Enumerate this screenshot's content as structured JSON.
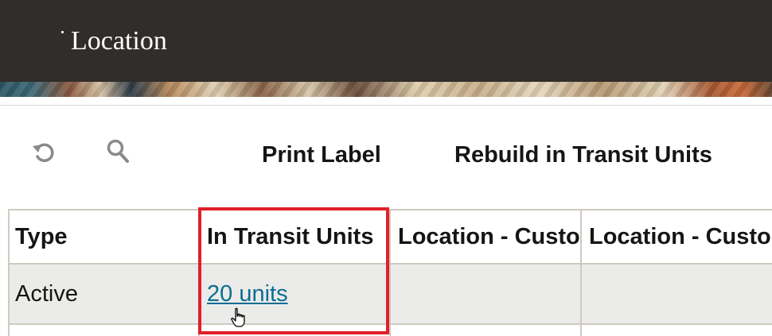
{
  "header": {
    "title": "Location"
  },
  "toolbar": {
    "refresh_icon": "refresh-icon",
    "search_icon": "search-icon",
    "print_label": "Print Label",
    "rebuild_label": "Rebuild in Transit Units"
  },
  "table": {
    "columns": [
      "Type",
      "In Transit Units",
      "Location - Customer",
      "Location - Customer"
    ],
    "rows": [
      {
        "type": "Active",
        "in_transit_units": "20 units",
        "col3": "",
        "col4": ""
      }
    ]
  },
  "colors": {
    "header_bg": "#312d2a",
    "highlight": "#e0202a",
    "link": "#0a6e94",
    "row_bg": "#ebebea"
  }
}
